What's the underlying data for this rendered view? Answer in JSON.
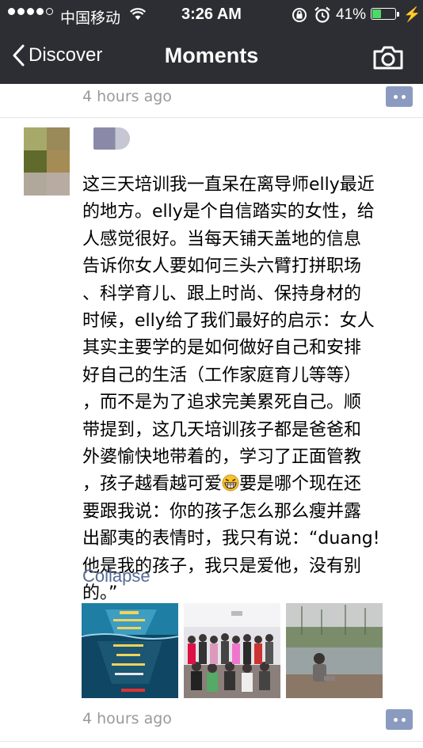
{
  "status_bar": {
    "carrier": "中国移动",
    "time": "3:26 AM",
    "battery": "41%",
    "battery_level": 0.41,
    "signal_bars": 4,
    "signal_total": 5
  },
  "nav": {
    "back_label": "Discover",
    "title": "Moments",
    "camera_icon": "camera-icon"
  },
  "previous_post": {
    "time": "4 hours ago"
  },
  "post": {
    "text_lines": [
      "这三天培训我一直呆在离导师elly最近",
      "的地方。elly是个自信踏实的女性，给",
      "人感觉很好。当每天铺天盖地的信息",
      "告诉你女人要如何三头六臂打拼职场",
      "、科学育儿、跟上时尚、保持身材的",
      "时候，elly给了我们最好的启示：女人",
      "其实主要学的是如何做好自己和安排",
      "好自己的生活（工作家庭育儿等等）",
      "，而不是为了追求完美累死自己。顺",
      "带提到，这几天培训孩子都是爸爸和",
      "外婆愉快地带着的，学习了正面管教",
      "，孩子越看越可爱",
      "要是哪个现在还",
      "要跟我说：你的孩子怎么那么瘦并露",
      "出鄙夷的表情时，我只有说：“duang!",
      "他是我的孩子，我只是爱他，没有别",
      "的。”"
    ],
    "collapse_label": "Collapse",
    "time": "4 hours ago",
    "photos": [
      {
        "name": "photo-poster",
        "colors": [
          "#1d6a8a",
          "#0d3b52"
        ]
      },
      {
        "name": "photo-group",
        "colors": [
          "#d8d8dc",
          "#6b5a56"
        ]
      },
      {
        "name": "photo-child-pond",
        "colors": [
          "#b8bcbc",
          "#7f8a86"
        ]
      }
    ]
  },
  "colors": {
    "bar": "#2d2e33",
    "link": "#576b95",
    "comment_button": "#8a9bbf",
    "battery_fill": "#4cd964"
  }
}
